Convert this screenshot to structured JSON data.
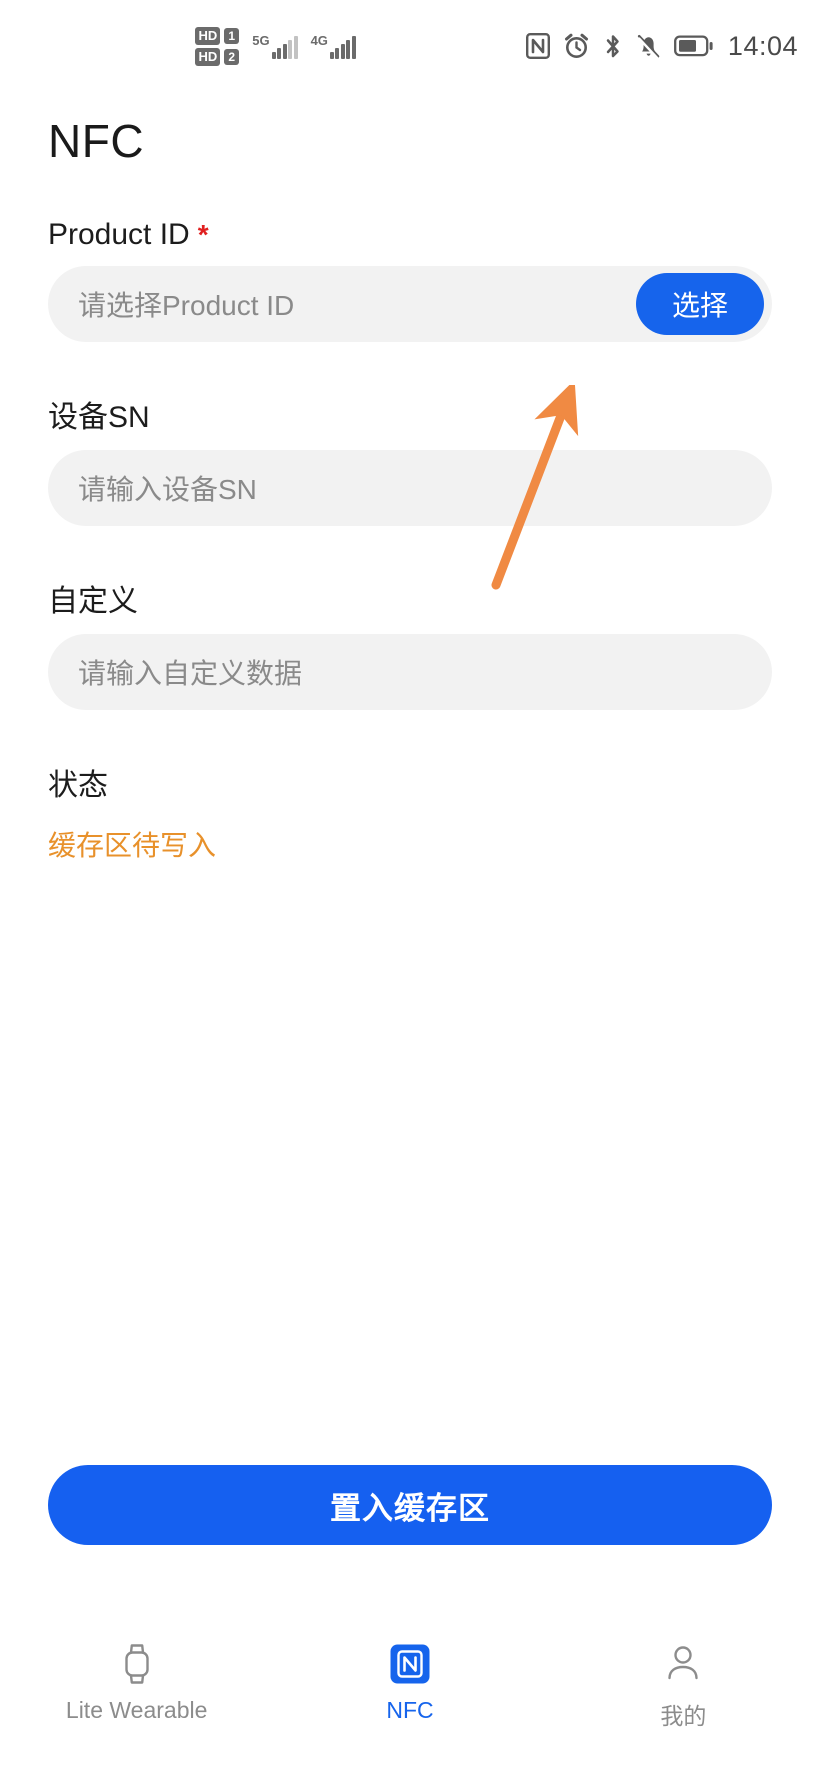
{
  "statusbar": {
    "hd_label_1": "HD",
    "sim_1": "1",
    "hd_label_2": "HD",
    "sim_2": "2",
    "network_1": "5G",
    "network_2": "4G",
    "time": "14:04",
    "icons": [
      "nfc-icon",
      "alarm-icon",
      "bluetooth-icon",
      "bell-muted-icon",
      "battery-icon"
    ]
  },
  "page": {
    "title": "NFC"
  },
  "form": {
    "product_id": {
      "label": "Product ID",
      "required_marker": "*",
      "placeholder": "请选择Product ID",
      "value": "",
      "button_label": "选择"
    },
    "device_sn": {
      "label": "设备SN",
      "placeholder": "请输入设备SN",
      "value": ""
    },
    "custom": {
      "label": "自定义",
      "placeholder": "请输入自定义数据",
      "value": ""
    },
    "status": {
      "label": "状态",
      "value": "缓存区待写入"
    }
  },
  "actions": {
    "primary_label": "置入缓存区"
  },
  "tabbar": {
    "items": [
      {
        "label": "Lite Wearable",
        "icon": "watch-icon",
        "active": false
      },
      {
        "label": "NFC",
        "icon": "nfc-badge-icon",
        "active": true
      },
      {
        "label": "我的",
        "icon": "person-icon",
        "active": false
      }
    ]
  },
  "colors": {
    "accent_blue": "#1664ec",
    "primary_button_blue": "#1560f0",
    "status_orange": "#e8912b",
    "required_red": "#e02020",
    "field_grey": "#f2f2f2",
    "annotation_orange": "#f08a43"
  },
  "annotation": {
    "type": "arrow",
    "points_to": "选择 button"
  }
}
